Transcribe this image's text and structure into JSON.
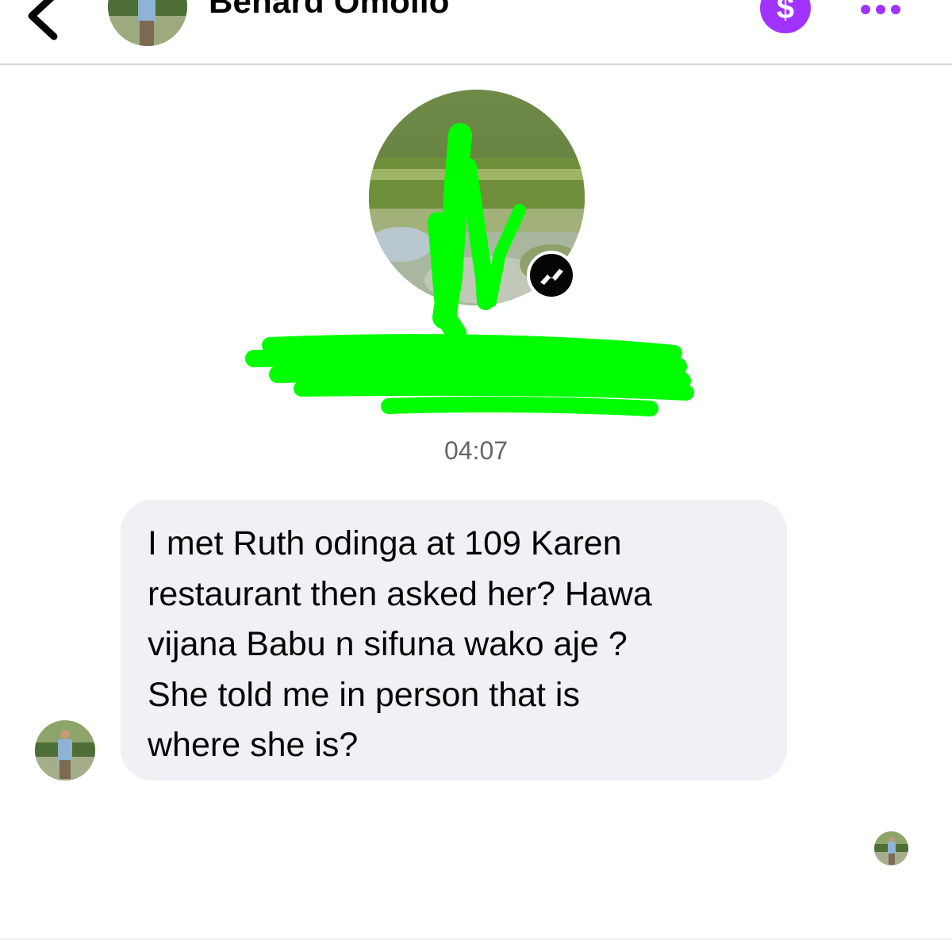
{
  "header": {
    "contact_name": "Benard Omollo",
    "back_icon": "chevron-left-icon",
    "pay_icon": "dollar-sign-icon",
    "pay_label": "$",
    "more_icon": "more-horizontal-icon",
    "accent_color": "#a033ff"
  },
  "profile": {
    "badge_icon": "messenger-icon",
    "redaction_color": "#00ff00"
  },
  "conversation": {
    "timestamp": "04:07",
    "messages": [
      {
        "direction": "incoming",
        "lines": [
          "I met Ruth odinga at 109 Karen",
          "restaurant then asked her? Hawa",
          "vijana Babu n sifuna wako aje ?",
          "She told me in person that is",
          "where she is?"
        ]
      }
    ]
  }
}
